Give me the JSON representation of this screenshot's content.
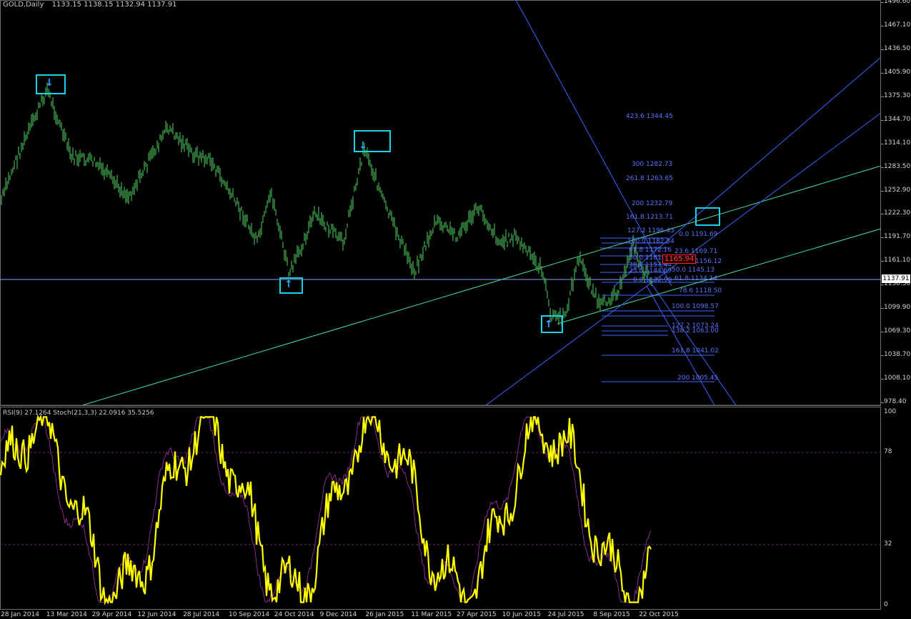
{
  "main_title": "GOLD,Daily",
  "ohlc": "1133.15 1138.15 1132.94 1137.91",
  "current_price": "1137.91",
  "marked_price": "1165.94",
  "price_axis": [
    "1496.60",
    "1467.10",
    "1436.50",
    "1405.90",
    "1375.30",
    "1344.70",
    "1314.10",
    "1283.50",
    "1252.90",
    "1222.30",
    "1191.70",
    "1161.10",
    "1130.50",
    "1099.90",
    "1069.30",
    "1038.70",
    "1008.10",
    "978.40"
  ],
  "date_axis": [
    "28 Jan 2014",
    "13 Mar 2014",
    "29 Apr 2014",
    "12 Jun 2014",
    "28 Jul 2014",
    "10 Sep 2014",
    "24 Oct 2014",
    "9 Dec 2014",
    "26 Jan 2015",
    "11 Mar 2015",
    "27 Apr 2015",
    "10 Jun 2015",
    "24 Jul 2015",
    "8 Sep 2015",
    "22 Oct 2015"
  ],
  "fibo_levels": {
    "ext_up": [
      "423.6 1344.45",
      "300 1282.73",
      "261.8 1263.65",
      "200 1232.79",
      "161.8 1213.71",
      "127.2 1196.43",
      "100.0 1182.84"
    ],
    "retr_small": [
      "0.0 1191.69",
      "23.6 1169.71",
      "38.2 1156.12",
      "50.0 1145.13",
      "61.8 1134.14",
      "78.6 1118.50",
      "100.0 1098.57",
      "127.2 1073.24",
      "138.2 1063.00",
      "161.8 1041.02",
      "200 1005.45"
    ],
    "inner": [
      "61.8 1172.16",
      "50.0 1161.36",
      "38.2 1157.44",
      "23.6 1144.69",
      "0.0 1132.90"
    ]
  },
  "indicator_title": "RSI(9) 27.1264  Stoch(21,3,3) 22.0916 35.5256",
  "indicator_axis": [
    "100",
    "78",
    "32",
    "0"
  ],
  "colors": {
    "candles": "#3fa34d",
    "rsi": "#ffff00",
    "stoch": "#8a2a8a",
    "trend_green": "#3fe0a0",
    "trend_blue": "#3a64ff",
    "marker": "#19d2e6",
    "arrow": "#2aa6ff"
  },
  "icons": [
    "arrow-down-icon",
    "arrow-down-icon",
    "arrow-up-icon",
    "arrow-up-icon"
  ]
}
